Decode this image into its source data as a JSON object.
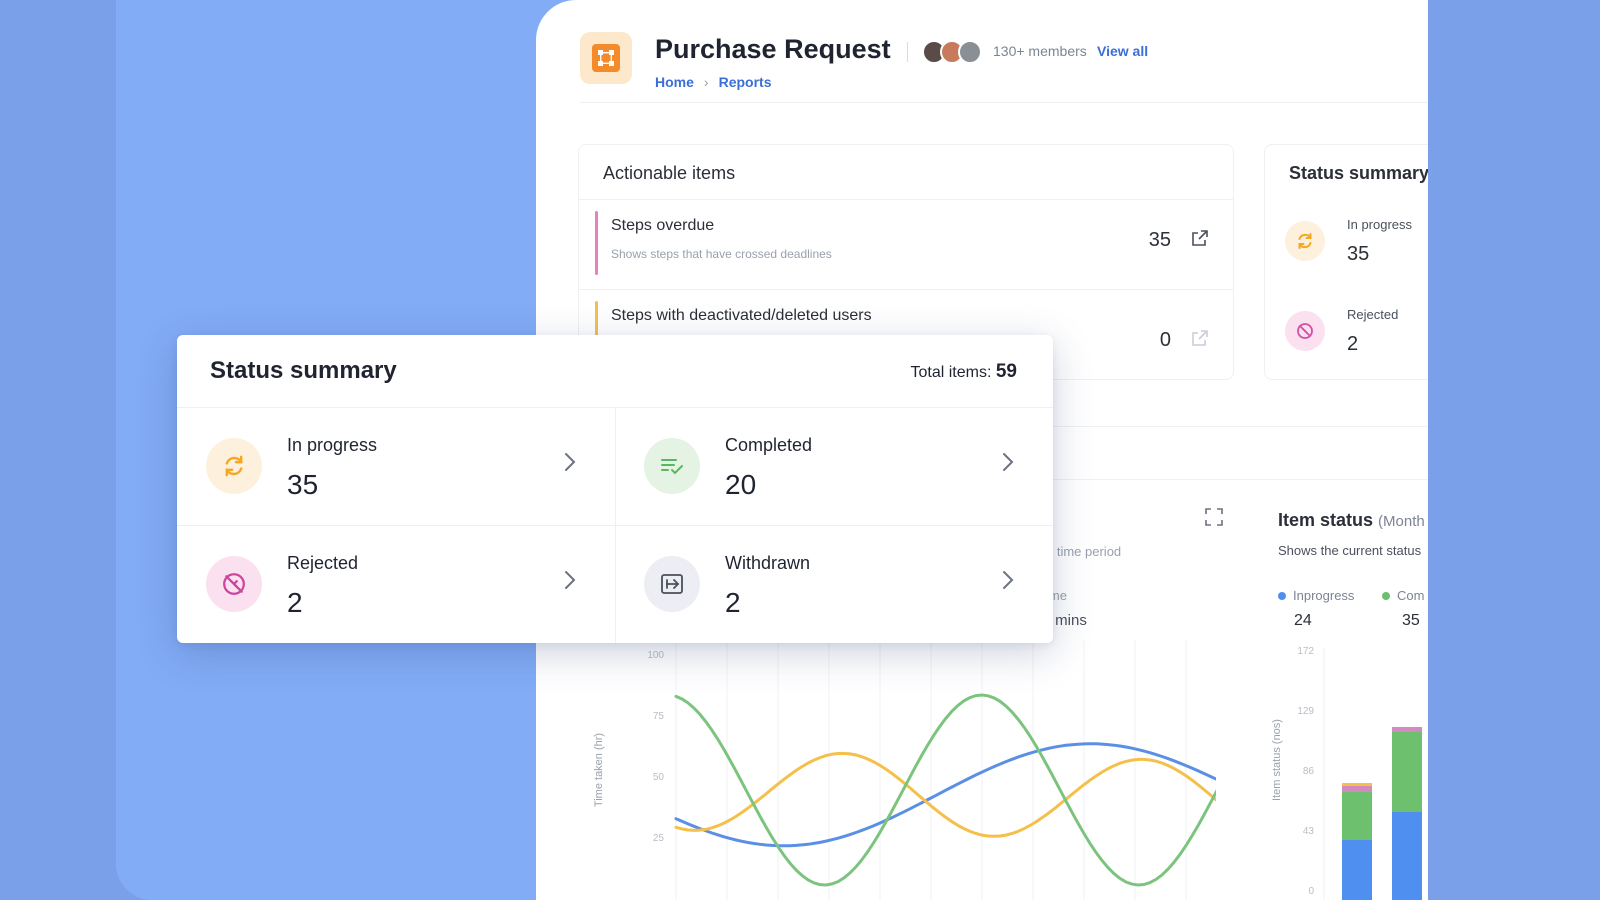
{
  "header": {
    "title": "Purchase Request",
    "members": "130+ members",
    "view_all": "View all",
    "breadcrumb": [
      "Home",
      "Reports"
    ]
  },
  "actionable": {
    "title": "Actionable items",
    "rows": [
      {
        "title": "Steps overdue",
        "desc": "Shows steps that have crossed deadlines",
        "count": "35",
        "color": "#e77fc1"
      },
      {
        "title": "Steps with deactivated/deleted users",
        "desc": "",
        "count": "0",
        "color": "#f5c04a"
      }
    ]
  },
  "side_summary": {
    "title": "Status summary",
    "items": [
      {
        "label": "In progress",
        "value": "35"
      },
      {
        "label": "Rejected",
        "value": "2"
      }
    ]
  },
  "time_chart": {
    "subtitle": "d time period",
    "stat_label": "ime",
    "stat_value": ") mins",
    "ylabel": "Time taken (hr)",
    "ticks": [
      "100",
      "75",
      "50",
      "25"
    ]
  },
  "item_status": {
    "title": "Item status",
    "period": "(Month",
    "subtitle": "Shows the current status",
    "legend": [
      {
        "name": "Inprogress",
        "value": "24",
        "color": "#4f8ff0"
      },
      {
        "name": "Com",
        "value": "35",
        "color": "#6cc06e"
      }
    ],
    "ylabel": "Item status (nos)",
    "ticks": [
      "172",
      "129",
      "86",
      "43",
      "0"
    ]
  },
  "status_card": {
    "title": "Status summary",
    "total_label": "Total items:",
    "total_value": "59",
    "cells": [
      {
        "label": "In progress",
        "value": "35",
        "icon": "refresh-icon"
      },
      {
        "label": "Completed",
        "value": "20",
        "icon": "list-check-icon"
      },
      {
        "label": "Rejected",
        "value": "2",
        "icon": "cancel-circle-icon"
      },
      {
        "label": "Withdrawn",
        "value": "2",
        "icon": "withdraw-icon"
      }
    ]
  },
  "colors": {
    "accent": "#3b6fd8",
    "orange": "#f38b2b",
    "green": "#6cc06e",
    "blue": "#4f8ff0",
    "yellow": "#f5c04a",
    "pink": "#d44ea8"
  }
}
